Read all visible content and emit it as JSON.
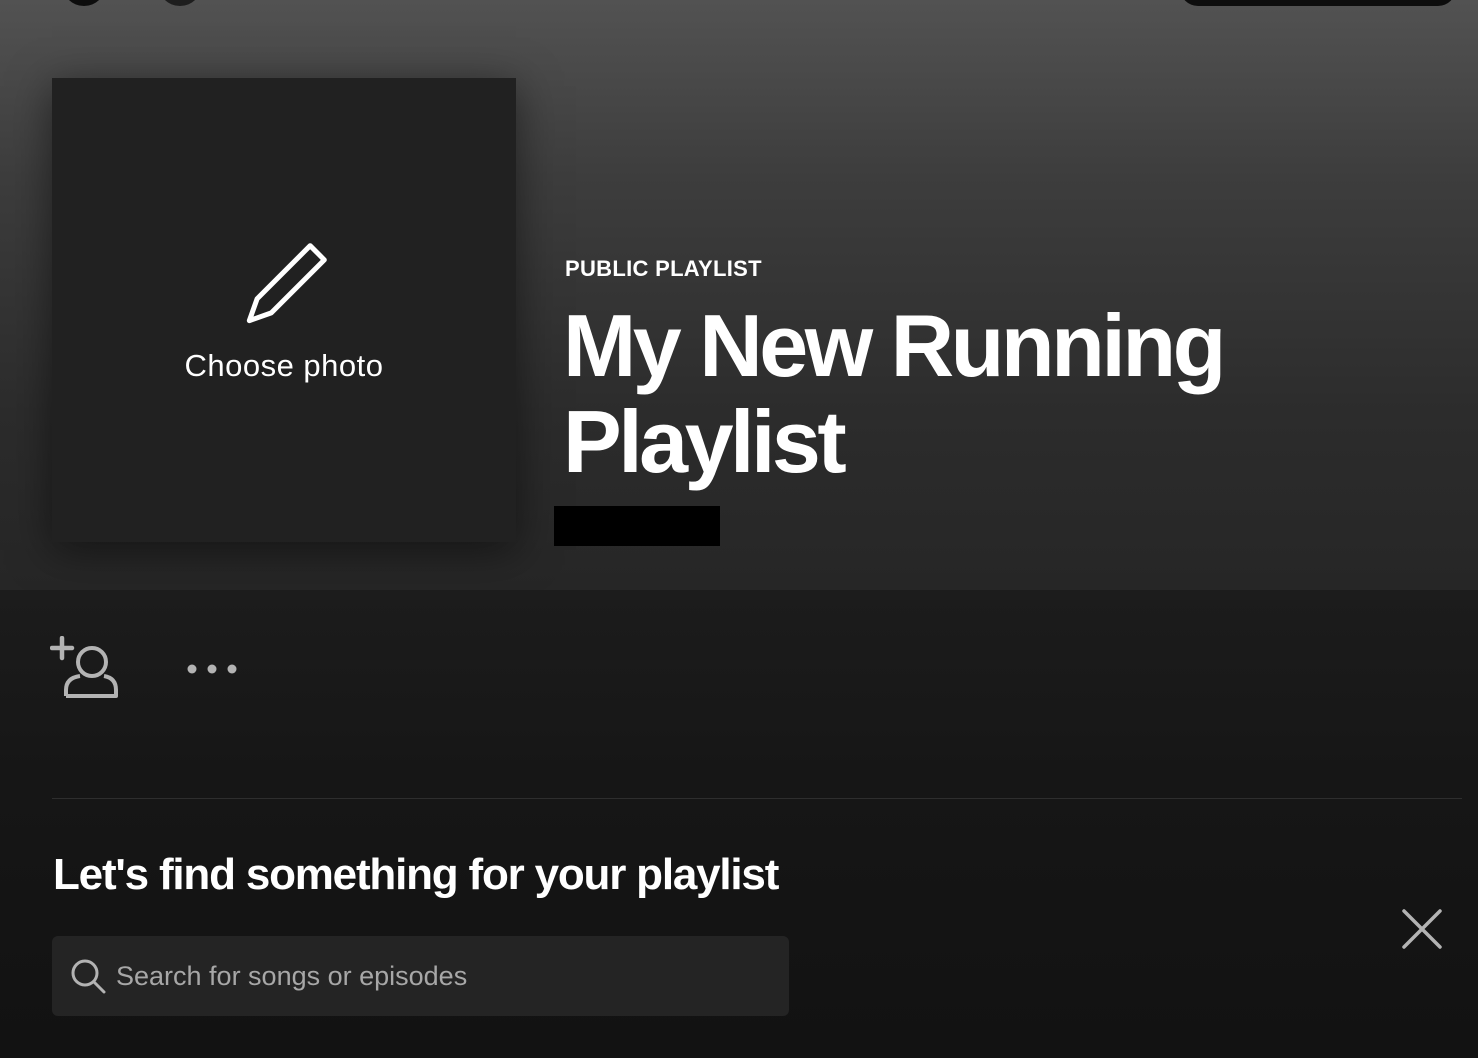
{
  "header": {
    "cover": {
      "icon": "pencil-icon",
      "label": "Choose photo"
    },
    "playlist_type": "PUBLIC PLAYLIST",
    "title": "My New Running Playlist"
  },
  "actions": {
    "invite_icon": "add-user-icon",
    "more_icon": "more-options-icon"
  },
  "recommend": {
    "heading": "Let's find something for your playlist",
    "search_placeholder": "Search for songs or episodes",
    "search_icon": "search-icon",
    "close_icon": "close-icon"
  },
  "colors": {
    "background": "#121212",
    "cover": "#212121",
    "search_field": "#242424",
    "text_primary": "#ffffff",
    "text_secondary": "#a7a7a7"
  }
}
